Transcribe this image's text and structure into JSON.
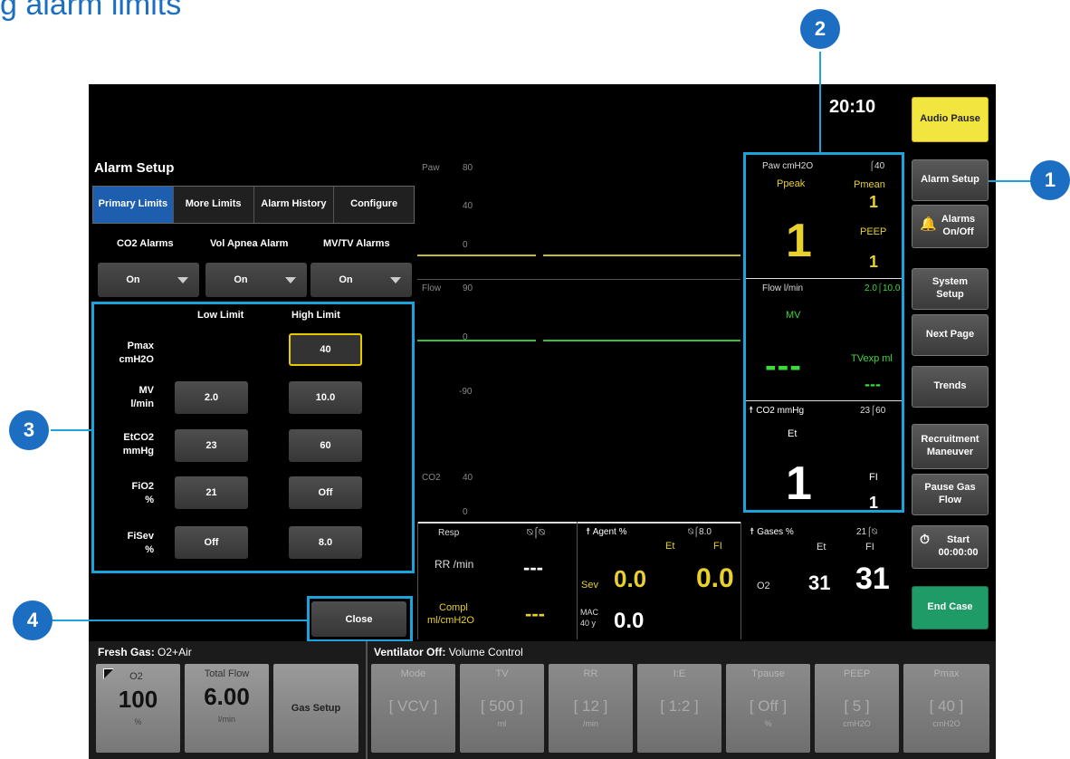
{
  "doc_title": "g alarm limits",
  "clock": "20:10",
  "right_buttons": {
    "audio_pause": "Audio Pause",
    "alarm_setup": "Alarm Setup",
    "alarms_onoff": "Alarms On/Off",
    "system_setup": "System Setup",
    "next_page": "Next Page",
    "trends": "Trends",
    "recruitment": "Recruitment Maneuver",
    "pause_gas": "Pause Gas Flow",
    "start_label": "Start",
    "start_time": "00:00:00",
    "end_case": "End Case"
  },
  "alarm_setup": {
    "title": "Alarm Setup",
    "tabs": [
      "Primary Limits",
      "More Limits",
      "Alarm History",
      "Configure"
    ],
    "co2_alarms": {
      "label": "CO2 Alarms",
      "value": "On"
    },
    "vol_apnea": {
      "label": "Vol Apnea Alarm",
      "value": "On"
    },
    "mvtv": {
      "label": "MV/TV Alarms",
      "value": "On"
    },
    "low_limit_header": "Low Limit",
    "high_limit_header": "High Limit",
    "rows": [
      {
        "label": "Pmax",
        "unit": "cmH2O",
        "low": "",
        "high": "40"
      },
      {
        "label": "MV",
        "unit": "l/min",
        "low": "2.0",
        "high": "10.0"
      },
      {
        "label": "EtCO2",
        "unit": "mmHg",
        "low": "23",
        "high": "60"
      },
      {
        "label": "FiO2",
        "unit": "%",
        "low": "21",
        "high": "Off"
      },
      {
        "label": "FiSev",
        "unit": "%",
        "low": "Off",
        "high": "8.0"
      }
    ],
    "close": "Close"
  },
  "waveforms": {
    "paw_label": "Paw",
    "paw_top": "80",
    "paw_mid": "40",
    "paw_zero": "0",
    "flow_label": "Flow",
    "flow_top": "90",
    "flow_zero": "0",
    "flow_neg": "-90",
    "co2_label": "CO2",
    "co2_top": "40",
    "co2_zero": "0"
  },
  "params": {
    "paw_title": "Paw cmH2O",
    "paw_limit": "40",
    "ppeak_label": "Ppeak",
    "ppeak_value": "1",
    "pmean_label": "Pmean",
    "pmean_value": "1",
    "peep_label": "PEEP",
    "peep_value": "1",
    "flow_title": "Flow l/min",
    "flow_limit": "2.0⌠10.0",
    "mv_label": "MV",
    "mv_value": "---",
    "tvexp_label": "TVexp ml",
    "tvexp_value": "---",
    "co2_title": "CO2 mmHg",
    "co2_limit": "23⌠60",
    "et_label": "Et",
    "et_value": "1",
    "fi_label": "FI",
    "fi_value": "1"
  },
  "resp": {
    "title": "Resp",
    "rr_label": "RR /min",
    "rr_value": "---",
    "compl_label": "Compl",
    "compl_unit": "ml/cmH2O",
    "compl_value": "---"
  },
  "agent": {
    "title": "Agent %",
    "limit": "8.0",
    "et_label": "Et",
    "fi_label": "FI",
    "sev_label": "Sev",
    "sev_et": "0.0",
    "sev_fi": "0.0",
    "mac_label": "MAC",
    "mac_age": "40 y",
    "mac_value": "0.0"
  },
  "gases": {
    "title": "Gases %",
    "limit": "21",
    "et_label": "Et",
    "fi_label": "FI",
    "o2_label": "O2",
    "o2_et": "31",
    "o2_fi": "31"
  },
  "fresh_gas": {
    "title": "Fresh Gas:",
    "mode": "O2+Air",
    "o2_label": "O2",
    "o2_value": "100",
    "o2_unit": "%",
    "flow_label": "Total Flow",
    "flow_value": "6.00",
    "flow_unit": "l/min",
    "gas_setup": "Gas Setup"
  },
  "ventilator": {
    "title": "Ventilator Off:",
    "mode": "Volume Control",
    "cells": [
      {
        "label": "Mode",
        "value": "[ VCV ]",
        "unit": ""
      },
      {
        "label": "TV",
        "value": "[ 500 ]",
        "unit": "ml"
      },
      {
        "label": "RR",
        "value": "[ 12 ]",
        "unit": "/min"
      },
      {
        "label": "I:E",
        "value": "[ 1:2 ]",
        "unit": ""
      },
      {
        "label": "Tpause",
        "value": "[ Off ]",
        "unit": "%"
      },
      {
        "label": "PEEP",
        "value": "[ 5 ]",
        "unit": "cmH2O"
      },
      {
        "label": "Pmax",
        "value": "[ 40 ]",
        "unit": "cmH2O"
      }
    ]
  },
  "callouts": [
    "1",
    "2",
    "3",
    "4"
  ]
}
